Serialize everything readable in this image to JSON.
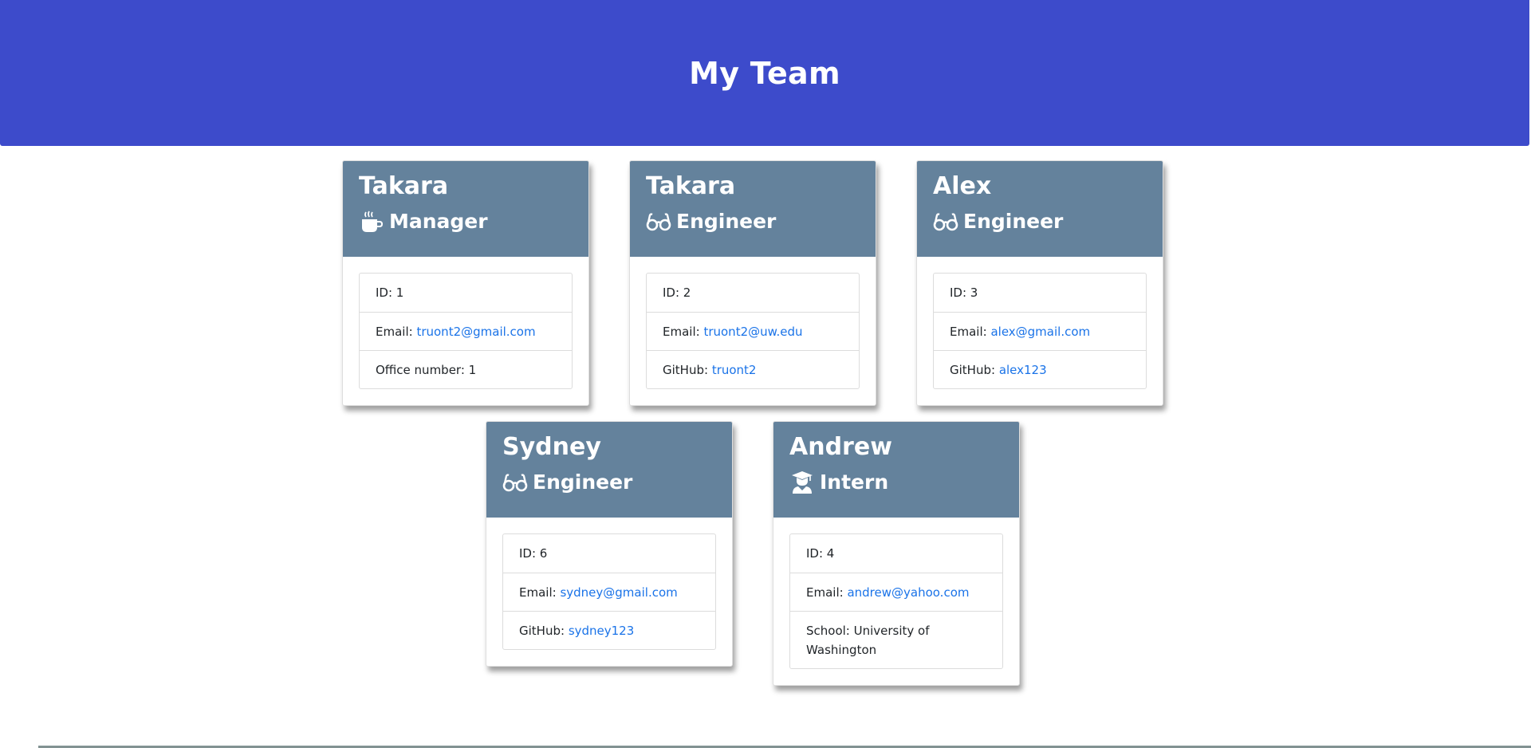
{
  "header": {
    "title": "My Team"
  },
  "cards": [
    {
      "name": "Takara",
      "role": "Manager",
      "icon": "coffee-icon",
      "id_label": "ID: ",
      "id": "1",
      "email_label": "Email: ",
      "email": "truont2@gmail.com",
      "extra_label": "Office number: ",
      "extra_value": "1"
    },
    {
      "name": "Takara",
      "role": "Engineer",
      "icon": "glasses-icon",
      "id_label": "ID: ",
      "id": "2",
      "email_label": "Email: ",
      "email": "truont2@uw.edu",
      "extra_label": "GitHub: ",
      "extra_value": "truont2"
    },
    {
      "name": "Alex",
      "role": "Engineer",
      "icon": "glasses-icon",
      "id_label": "ID: ",
      "id": "3",
      "email_label": "Email: ",
      "email": "alex@gmail.com",
      "extra_label": "GitHub: ",
      "extra_value": "alex123"
    },
    {
      "name": "Sydney",
      "role": "Engineer",
      "icon": "glasses-icon",
      "id_label": "ID: ",
      "id": "6",
      "email_label": "Email: ",
      "email": "sydney@gmail.com",
      "extra_label": "GitHub: ",
      "extra_value": "sydney123"
    },
    {
      "name": "Andrew",
      "role": "Intern",
      "icon": "graduate-icon",
      "id_label": "ID: ",
      "id": "4",
      "email_label": "Email: ",
      "email": "andrew@yahoo.com",
      "extra_label": "School: ",
      "extra_value": "University of Washington"
    }
  ],
  "colors": {
    "header_bg": "#3d4bcb",
    "card_header_bg": "#64829c",
    "link": "#1a73e8"
  }
}
